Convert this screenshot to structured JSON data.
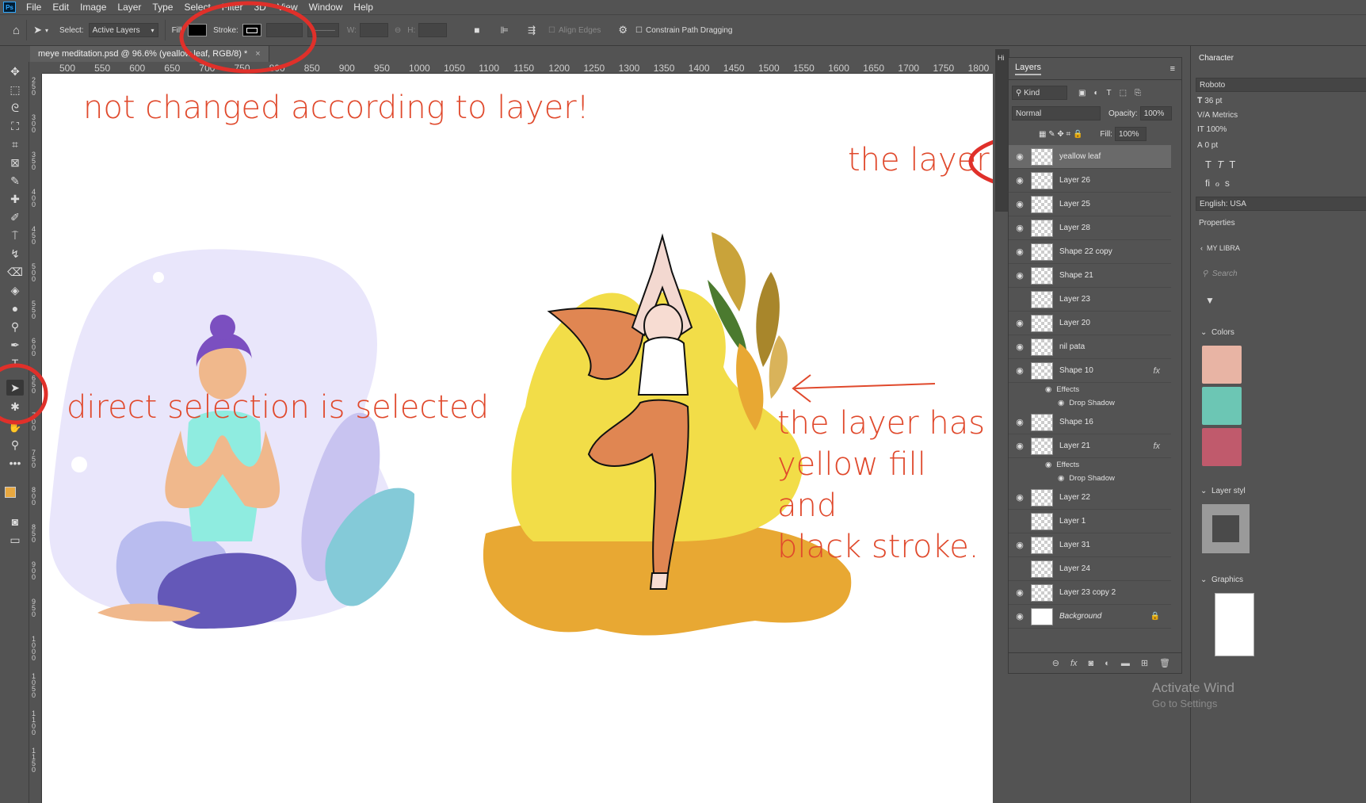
{
  "menu": [
    "File",
    "Edit",
    "Image",
    "Layer",
    "Type",
    "Select",
    "Filter",
    "3D",
    "View",
    "Window",
    "Help"
  ],
  "options": {
    "select_label": "Select:",
    "select_value": "Active Layers",
    "fill_label": "Fill:",
    "stroke_label": "Stroke:",
    "w_label": "W:",
    "h_label": "H:",
    "align_edges": "Align Edges",
    "constrain": "Constrain Path Dragging"
  },
  "document": {
    "tab_title": "meye meditation.psd @ 96.6% (yeallow leaf, RGB/8) *"
  },
  "ruler_top": [
    "500",
    "550",
    "600",
    "650",
    "700",
    "750",
    "800",
    "850",
    "900",
    "950",
    "1000",
    "1050",
    "1100",
    "1150",
    "1200",
    "1250",
    "1300",
    "1350",
    "1400",
    "1450",
    "1500",
    "1550",
    "1600",
    "1650",
    "1700",
    "1750",
    "1800"
  ],
  "ruler_left": [
    "250",
    "300",
    "350",
    "400",
    "450",
    "500",
    "550",
    "600",
    "650",
    "700",
    "750",
    "800",
    "850",
    "900",
    "950",
    "1000",
    "1050",
    "1100",
    "1150"
  ],
  "annotations": {
    "top": "not changed according to layer!",
    "left": "direct selection is selected",
    "layer_note": "the layer",
    "fill_note_1": "the layer has",
    "fill_note_2": "yellow fill and",
    "fill_note_3": "black stroke."
  },
  "layers_panel": {
    "title": "Layers",
    "kind_label": "Kind",
    "blend_mode": "Normal",
    "opacity_label": "Opacity:",
    "opacity_value": "100%",
    "fill_label": "Fill:",
    "fill_value": "100%",
    "rows": [
      {
        "name": "yeallow leaf",
        "visible": true
      },
      {
        "name": "Layer 26",
        "visible": true
      },
      {
        "name": "Layer 25",
        "visible": true
      },
      {
        "name": "Layer 28",
        "visible": true
      },
      {
        "name": "Shape 22 copy",
        "visible": true
      },
      {
        "name": "Shape 21",
        "visible": true
      },
      {
        "name": "Layer 23",
        "visible": false
      },
      {
        "name": "Layer 20",
        "visible": true
      },
      {
        "name": "nil pata",
        "visible": true
      },
      {
        "name": "Shape 10",
        "visible": true
      },
      {
        "name": "Shape 16",
        "visible": true
      },
      {
        "name": "Layer 21",
        "visible": true
      },
      {
        "name": "Layer 22",
        "visible": true
      },
      {
        "name": "Layer 1",
        "visible": false
      },
      {
        "name": "Layer 31",
        "visible": true
      },
      {
        "name": "Layer 24",
        "visible": false
      },
      {
        "name": "Layer 23 copy 2",
        "visible": true
      },
      {
        "name": "Background",
        "visible": true
      }
    ],
    "effects_label": "Effects",
    "drop_shadow_label": "Drop Shadow",
    "fx_label": "fx"
  },
  "right_panel": {
    "hi_tab": "Hi",
    "character_title": "Character",
    "font": "Roboto",
    "size": "36 pt",
    "kerning": "Metrics",
    "scale": "100%",
    "baseline": "0 pt",
    "language": "English: USA",
    "properties": "Properties",
    "my_library": "MY LIBRA",
    "search_placeholder": "Search",
    "colors": "Colors",
    "layer_styles": "Layer styl",
    "graphics": "Graphics"
  },
  "watermark": {
    "line1": "Activate Wind",
    "line2": "Go to Settings"
  },
  "colors": {
    "annotation": "#e0492c",
    "swatch1": "#e8b4a4",
    "swatch2": "#6cc6b4",
    "swatch3": "#c05a6c",
    "fg": "#e8a840"
  }
}
